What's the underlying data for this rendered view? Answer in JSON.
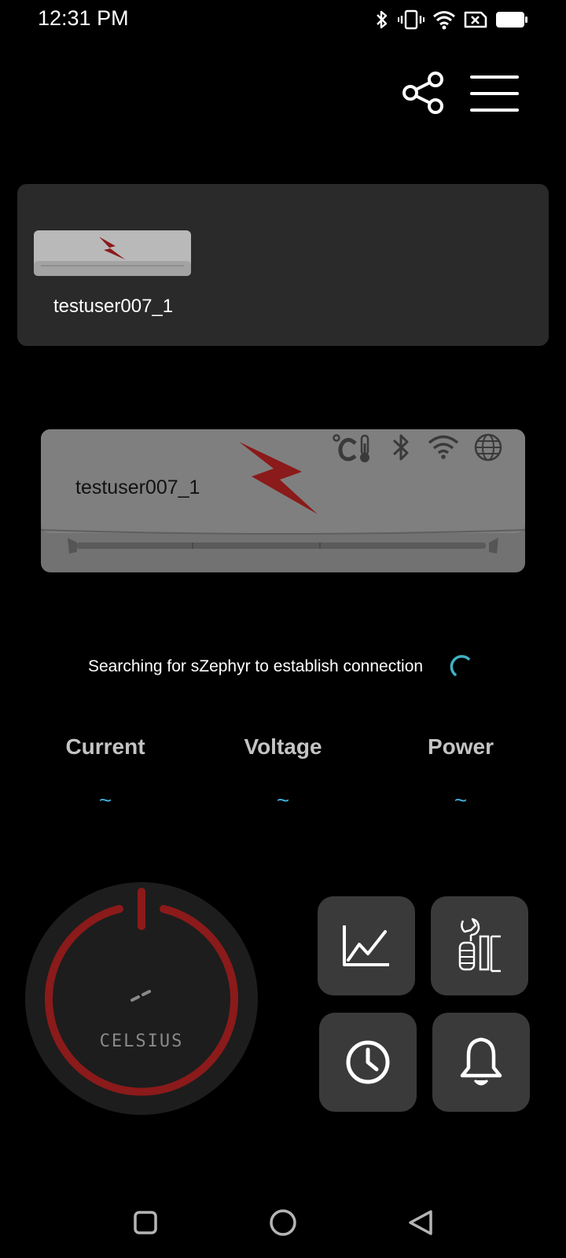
{
  "status_bar": {
    "time": "12:31 PM",
    "icons": [
      "bluetooth-icon",
      "vibrate-icon",
      "wifi-icon",
      "no-sim-icon",
      "battery-icon"
    ]
  },
  "header": {
    "actions": [
      "share-icon",
      "menu-icon"
    ]
  },
  "device_card": {
    "device_name": "testuser007_1"
  },
  "ac_unit": {
    "device_name": "testuser007_1",
    "indicators": [
      "celsius-thermometer-icon",
      "bluetooth-icon",
      "wifi-icon",
      "globe-icon"
    ]
  },
  "connection": {
    "status_text": "Searching for sZephyr to establish connection"
  },
  "metrics": [
    {
      "label": "Current",
      "value": "~"
    },
    {
      "label": "Voltage",
      "value": "~"
    },
    {
      "label": "Power",
      "value": "~"
    }
  ],
  "dial": {
    "temperature": "--",
    "unit": "CELSIUS"
  },
  "tiles": [
    "chart-icon",
    "service-icon",
    "clock-icon",
    "bell-icon"
  ],
  "nav": [
    "recents-button",
    "home-button",
    "back-button"
  ],
  "colors": {
    "background": "#000000",
    "card": "#2a2a2a",
    "tile": "#3a3a3a",
    "accent_red": "#8b1a1a",
    "value_blue": "#3fb1e0",
    "spinner_teal": "#3fb1c4"
  }
}
